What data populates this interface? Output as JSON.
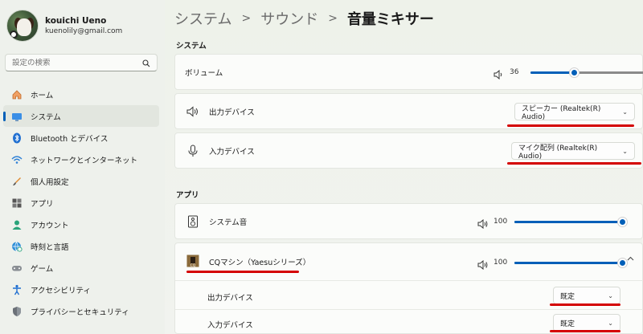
{
  "user": {
    "name": "kouichi Ueno",
    "email": "kuenolily@gmail.com"
  },
  "search": {
    "placeholder": "設定の検索"
  },
  "sidebar": {
    "items": [
      {
        "label": "ホーム",
        "icon": "home-icon"
      },
      {
        "label": "システム",
        "icon": "display-icon",
        "active": true
      },
      {
        "label": "Bluetooth とデバイス",
        "icon": "bluetooth-icon"
      },
      {
        "label": "ネットワークとインターネット",
        "icon": "wifi-icon"
      },
      {
        "label": "個人用設定",
        "icon": "brush-icon"
      },
      {
        "label": "アプリ",
        "icon": "apps-icon"
      },
      {
        "label": "アカウント",
        "icon": "account-icon"
      },
      {
        "label": "時刻と言語",
        "icon": "globe-clock-icon"
      },
      {
        "label": "ゲーム",
        "icon": "gamepad-icon"
      },
      {
        "label": "アクセシビリティ",
        "icon": "accessibility-icon"
      },
      {
        "label": "プライバシーとセキュリティ",
        "icon": "shield-icon"
      }
    ]
  },
  "breadcrumb": {
    "level1": "システム",
    "level2": "サウンド",
    "current": "音量ミキサー",
    "separator": ">"
  },
  "system_section": {
    "title": "システム",
    "volume": {
      "label": "ボリューム",
      "value": "36",
      "level": 0.36
    },
    "output": {
      "label": "出力デバイス",
      "selected": "スピーカー (Realtek(R) Audio)"
    },
    "input": {
      "label": "入力デバイス",
      "selected": "マイク配列 (Realtek(R) Audio)"
    }
  },
  "apps_section": {
    "title": "アプリ",
    "system_sounds": {
      "label": "システム音",
      "value": "100",
      "level": 1.0
    },
    "cq": {
      "label": "CQマシン（Yaesuシリーズ）",
      "value": "100",
      "level": 1.0,
      "output": {
        "label": "出力デバイス",
        "selected": "既定"
      },
      "input": {
        "label": "入力デバイス",
        "selected": "既定"
      }
    }
  },
  "colors": {
    "accent": "#005fb8",
    "annotation": "#d40000"
  }
}
